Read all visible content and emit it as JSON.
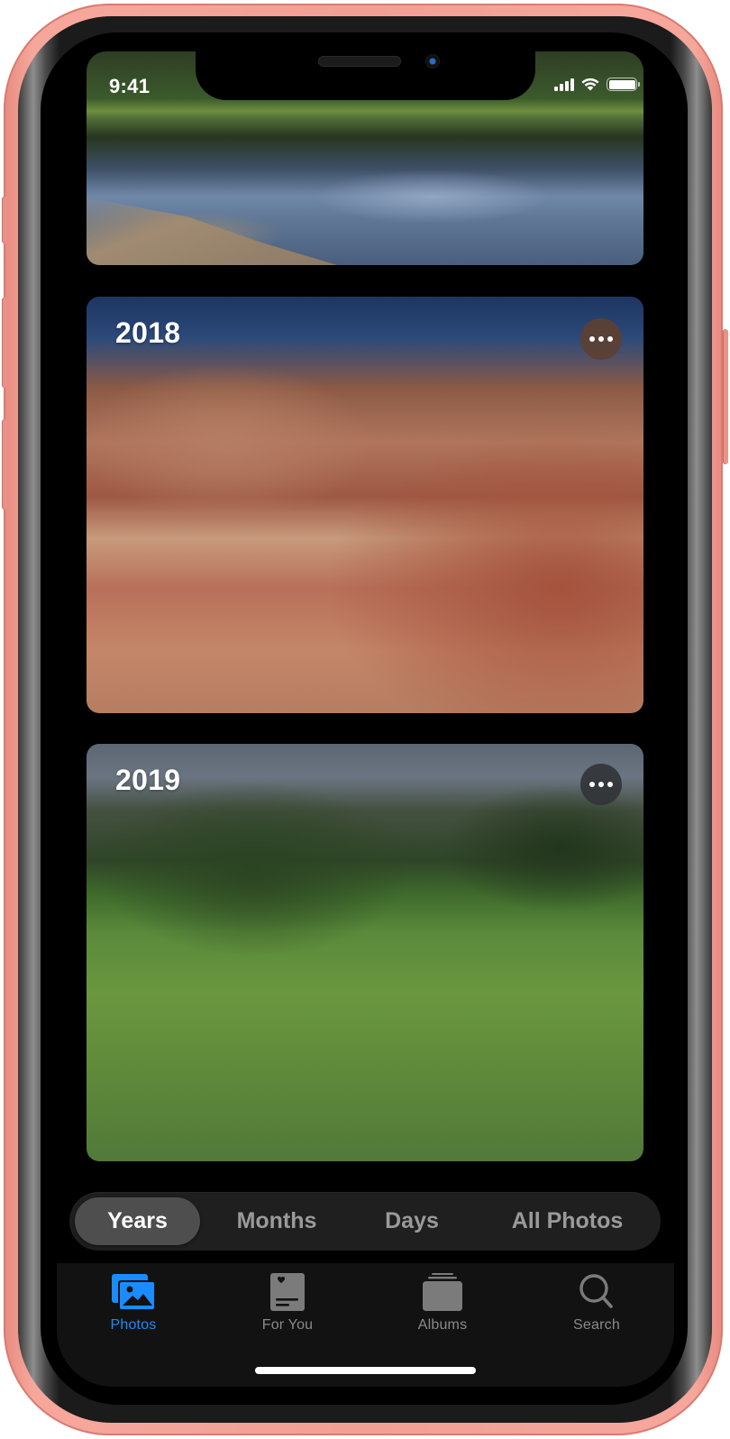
{
  "status_bar": {
    "time": "9:41",
    "icons": [
      "cellular-signal-icon",
      "wifi-icon",
      "battery-icon"
    ]
  },
  "cards": [
    {
      "photo": "lake-with-ripples",
      "year": "",
      "has_more_button": false
    },
    {
      "photo": "painted-hills-cartwheel",
      "year": "2018",
      "has_more_button": true,
      "more_icon": "ellipsis-icon"
    },
    {
      "photo": "alpine-meadow-children",
      "year": "2019",
      "has_more_button": true,
      "more_icon": "ellipsis-icon"
    }
  ],
  "segmented_control": {
    "selected": "Years",
    "options": [
      "Years",
      "Months",
      "Days",
      "All Photos"
    ]
  },
  "tab_bar": {
    "selected": "Photos",
    "accent_color": "#1a8cff",
    "inactive_color": "#8a8a8a",
    "items": [
      {
        "label": "Photos",
        "icon": "photos-icon"
      },
      {
        "label": "For You",
        "icon": "for-you-icon"
      },
      {
        "label": "Albums",
        "icon": "albums-icon"
      },
      {
        "label": "Search",
        "icon": "search-icon"
      }
    ]
  },
  "device": {
    "frame_color": "#f3a094"
  }
}
